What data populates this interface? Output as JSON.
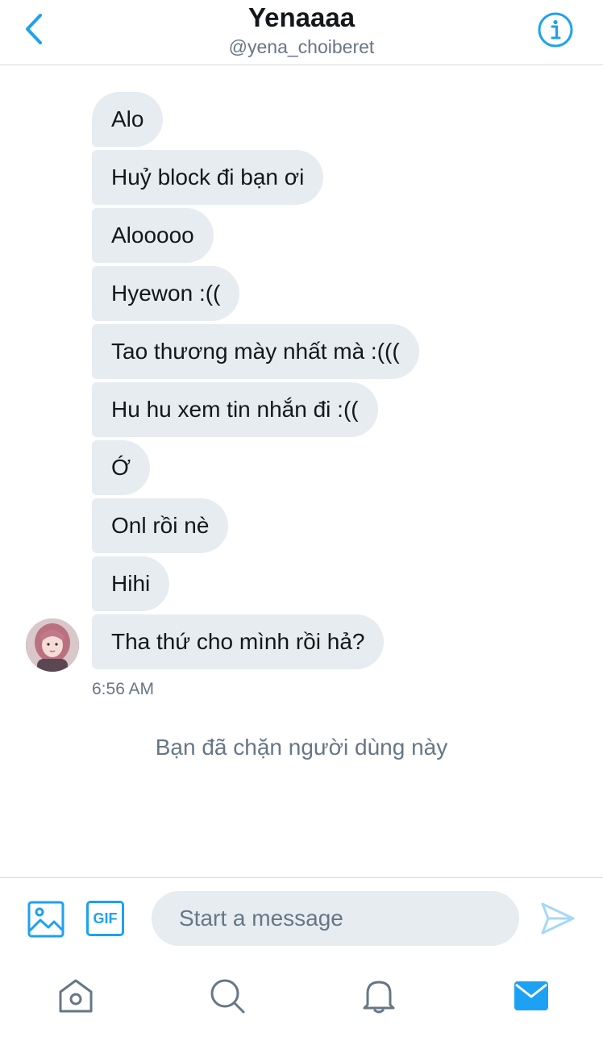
{
  "header": {
    "title": "Yenaaaa",
    "handle": "@yena_choiberet",
    "back_icon": "chevron-left-icon",
    "info_icon": "info-icon"
  },
  "messages": [
    {
      "text": "Alo"
    },
    {
      "text": "Huỷ block đi bạn ơi"
    },
    {
      "text": "Alooooo"
    },
    {
      "text": "Hyewon :(("
    },
    {
      "text": "Tao thương mày nhất mà :((("
    },
    {
      "text": "Hu hu xem tin nhắn đi :(("
    },
    {
      "text": "Ớ"
    },
    {
      "text": "Onl rồi nè"
    },
    {
      "text": "Hihi"
    },
    {
      "text": "Tha thứ cho mình rồi hả?"
    }
  ],
  "timestamp": "6:56 AM",
  "blocked_notice": "Bạn đã chặn người dùng này",
  "composer": {
    "placeholder": "Start a message",
    "gif_label": "GIF",
    "media_icon": "image-icon",
    "send_icon": "send-icon"
  },
  "nav": {
    "items": [
      "home-icon",
      "search-icon",
      "notifications-icon",
      "messages-icon"
    ]
  },
  "colors": {
    "accent": "#1da1f2",
    "bubble": "#e6ecf0",
    "muted_text": "#657786",
    "nav_icon": "#657786"
  }
}
